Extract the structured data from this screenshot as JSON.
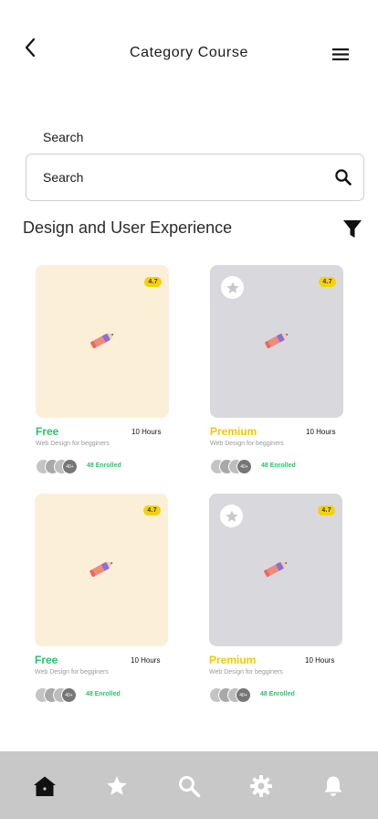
{
  "header": {
    "title": "Category Course"
  },
  "search": {
    "label": "Search",
    "placeholder": "Search"
  },
  "section": {
    "title": "Design and User Experience"
  },
  "courses": [
    {
      "rating": "4.7",
      "price": "Free",
      "hours": "10 Hours",
      "subtitle": "Web Design for begginers",
      "more_avatars": "40+",
      "enrolled": "48 Enrolled",
      "thumb": "yellow",
      "favorite": false
    },
    {
      "rating": "4.7",
      "price": "Premium",
      "hours": "10 Hours",
      "subtitle": "Web Design for begginers",
      "more_avatars": "40+",
      "enrolled": "48 Enrolled",
      "thumb": "grey",
      "favorite": true
    },
    {
      "rating": "4.7",
      "price": "Free",
      "hours": "10 Hours",
      "subtitle": "Web Design for begginers",
      "more_avatars": "40+",
      "enrolled": "48 Enrolled",
      "thumb": "yellow",
      "favorite": false
    },
    {
      "rating": "4.7",
      "price": "Premium",
      "hours": "10 Hours",
      "subtitle": "Web Design for begginers",
      "more_avatars": "40+",
      "enrolled": "48 Enrolled",
      "thumb": "grey",
      "favorite": true
    }
  ],
  "tabbar": {
    "items": [
      "home-icon",
      "star-icon",
      "search-icon",
      "settings-icon",
      "bell-icon"
    ],
    "active": "home-icon"
  },
  "colors": {
    "free": "#2cc26a",
    "premium": "#f5c60a",
    "rating_badge": "#f5d20a",
    "yellow_thumb": "#fbf0d7",
    "grey_thumb": "#d9d9dd",
    "tabbar": "#c8c8c8"
  }
}
